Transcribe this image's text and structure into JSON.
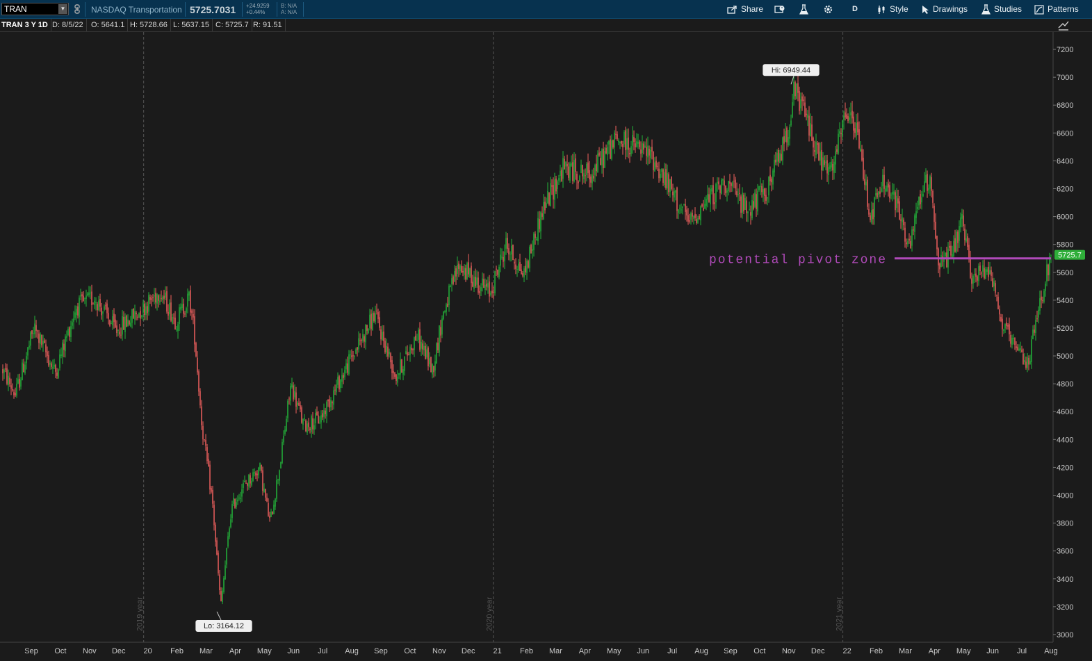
{
  "toolbar": {
    "symbol": "TRAN",
    "description": "NASDAQ Transportation",
    "last": "5725.7031",
    "net_change": "+24.9259",
    "pct_change": "+0.44%",
    "bid": "B: N/A",
    "ask": "A: N/A",
    "share_label": "Share",
    "aggregation": "D",
    "style_label": "Style",
    "drawings_label": "Drawings",
    "studies_label": "Studies",
    "patterns_label": "Patterns",
    "icons": [
      "link-icon",
      "share-icon",
      "snapshot-icon",
      "flask-icon",
      "gear-icon",
      "style-icon",
      "cursor-icon",
      "studies-icon",
      "patterns-icon"
    ]
  },
  "info": {
    "title": "TRAN 3 Y 1D",
    "date": "D: 8/5/22",
    "open": "O: 5641.1",
    "high": "H: 5728.66",
    "low": "L: 5637.15",
    "close": "C: 5725.7",
    "range": "R: 91.51"
  },
  "colors": {
    "up": "#23b53a",
    "down": "#f0605e",
    "pivot": "#b04ab9",
    "price_bubble": "#2faf3a",
    "background": "#1b1b1b",
    "toolbar": "#07324f"
  },
  "chart_data": {
    "type": "candlestick",
    "timeframe": "3 Y 1D",
    "y_axis": {
      "min": 2900,
      "max": 7300,
      "ticks": [
        3000,
        3200,
        3400,
        3600,
        3800,
        4000,
        4200,
        4400,
        4600,
        4800,
        5000,
        5200,
        5400,
        5600,
        5800,
        6000,
        6200,
        6400,
        6600,
        6800,
        7000,
        7200
      ]
    },
    "x_labels": [
      "Sep",
      "Oct",
      "Nov",
      "Dec",
      "20",
      "Feb",
      "Mar",
      "Apr",
      "May",
      "Jun",
      "Jul",
      "Aug",
      "Sep",
      "Oct",
      "Nov",
      "Dec",
      "21",
      "Feb",
      "Mar",
      "Apr",
      "May",
      "Jun",
      "Jul",
      "Aug",
      "Sep",
      "Oct",
      "Nov",
      "Dec",
      "22",
      "Feb",
      "Mar",
      "Apr",
      "May",
      "Jun",
      "Jul",
      "Aug"
    ],
    "year_dividers": [
      "2019 year",
      "2020 year",
      "2021 year"
    ],
    "path_anchors": [
      {
        "t": 0,
        "v": 4900
      },
      {
        "t": 0.012,
        "v": 4720
      },
      {
        "t": 0.03,
        "v": 5200
      },
      {
        "t": 0.05,
        "v": 4880
      },
      {
        "t": 0.07,
        "v": 5350
      },
      {
        "t": 0.088,
        "v": 5420
      },
      {
        "t": 0.108,
        "v": 5180
      },
      {
        "t": 0.135,
        "v": 5350
      },
      {
        "t": 0.15,
        "v": 5470
      },
      {
        "t": 0.165,
        "v": 5250
      },
      {
        "t": 0.178,
        "v": 5420
      },
      {
        "t": 0.183,
        "v": 5150
      },
      {
        "t": 0.19,
        "v": 4500
      },
      {
        "t": 0.2,
        "v": 3950
      },
      {
        "t": 0.208,
        "v": 3200
      },
      {
        "t": 0.218,
        "v": 3900
      },
      {
        "t": 0.228,
        "v": 4050
      },
      {
        "t": 0.245,
        "v": 4200
      },
      {
        "t": 0.255,
        "v": 3800
      },
      {
        "t": 0.265,
        "v": 4250
      },
      {
        "t": 0.275,
        "v": 4800
      },
      {
        "t": 0.287,
        "v": 4500
      },
      {
        "t": 0.303,
        "v": 4550
      },
      {
        "t": 0.33,
        "v": 4950
      },
      {
        "t": 0.355,
        "v": 5300
      },
      {
        "t": 0.375,
        "v": 4850
      },
      {
        "t": 0.395,
        "v": 5150
      },
      {
        "t": 0.41,
        "v": 4900
      },
      {
        "t": 0.42,
        "v": 5300
      },
      {
        "t": 0.435,
        "v": 5650
      },
      {
        "t": 0.465,
        "v": 5450
      },
      {
        "t": 0.48,
        "v": 5800
      },
      {
        "t": 0.497,
        "v": 5580
      },
      {
        "t": 0.515,
        "v": 6050
      },
      {
        "t": 0.535,
        "v": 6350
      },
      {
        "t": 0.56,
        "v": 6300
      },
      {
        "t": 0.585,
        "v": 6550
      },
      {
        "t": 0.605,
        "v": 6500
      },
      {
        "t": 0.62,
        "v": 6420
      },
      {
        "t": 0.64,
        "v": 6150
      },
      {
        "t": 0.655,
        "v": 5950
      },
      {
        "t": 0.67,
        "v": 6100
      },
      {
        "t": 0.69,
        "v": 6250
      },
      {
        "t": 0.71,
        "v": 6050
      },
      {
        "t": 0.73,
        "v": 6200
      },
      {
        "t": 0.748,
        "v": 6600
      },
      {
        "t": 0.755,
        "v": 6900
      },
      {
        "t": 0.765,
        "v": 6750
      },
      {
        "t": 0.78,
        "v": 6400
      },
      {
        "t": 0.79,
        "v": 6300
      },
      {
        "t": 0.805,
        "v": 6750
      },
      {
        "t": 0.815,
        "v": 6600
      },
      {
        "t": 0.828,
        "v": 6000
      },
      {
        "t": 0.84,
        "v": 6250
      },
      {
        "t": 0.855,
        "v": 6050
      },
      {
        "t": 0.865,
        "v": 5750
      },
      {
        "t": 0.875,
        "v": 6150
      },
      {
        "t": 0.885,
        "v": 6280
      },
      {
        "t": 0.893,
        "v": 5650
      },
      {
        "t": 0.905,
        "v": 5720
      },
      {
        "t": 0.915,
        "v": 5950
      },
      {
        "t": 0.925,
        "v": 5550
      },
      {
        "t": 0.942,
        "v": 5650
      },
      {
        "t": 0.952,
        "v": 5250
      },
      {
        "t": 0.965,
        "v": 5050
      },
      {
        "t": 0.978,
        "v": 4950
      },
      {
        "t": 0.99,
        "v": 5400
      },
      {
        "t": 1,
        "v": 5725
      }
    ],
    "high_label": "Hi: 6949.44",
    "low_label": "Lo: 3164.12",
    "high_value": 6949.44,
    "low_value": 3164.12,
    "last_price": 5725.7,
    "last_price_label": "5725.7",
    "annotation": {
      "text": "potential pivot zone",
      "level": 5700
    }
  }
}
